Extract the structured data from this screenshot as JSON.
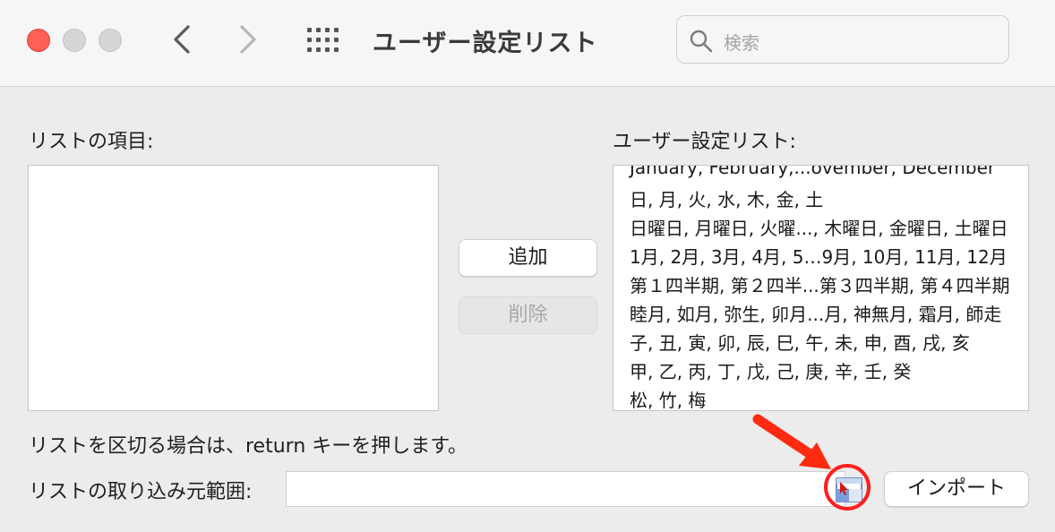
{
  "window": {
    "title": "ユーザー設定リスト",
    "search_placeholder": "検索"
  },
  "main": {
    "list_items_label": "リストの項目:",
    "custom_lists_label": "ユーザー設定リスト:",
    "add_button": "追加",
    "delete_button": "削除",
    "custom_lists": [
      "January, February,...ovember, December",
      "日, 月, 火, 水, 木, 金, 土",
      "日曜日, 月曜日, 火曜..., 木曜日, 金曜日, 土曜日",
      "1月, 2月, 3月, 4月, 5…9月, 10月, 11月, 12月",
      "第１四半期, 第２四半...第３四半期, 第４四半期",
      "睦月, 如月, 弥生, 卯月...月, 神無月, 霜月, 師走",
      "子, 丑, 寅, 卯, 辰, 巳, 午, 未, 申, 酉, 戌, 亥",
      "甲, 乙, 丙, 丁, 戊, 己, 庚, 辛, 壬, 癸",
      "松, 竹, 梅"
    ],
    "hint": "リストを区切る場合は、return キーを押します。",
    "range_label": "リストの取り込み元範囲:",
    "range_value": "",
    "import_button": "インポート"
  },
  "colors": {
    "close": "#fe5f57",
    "annotation": "#ff1e1e"
  }
}
